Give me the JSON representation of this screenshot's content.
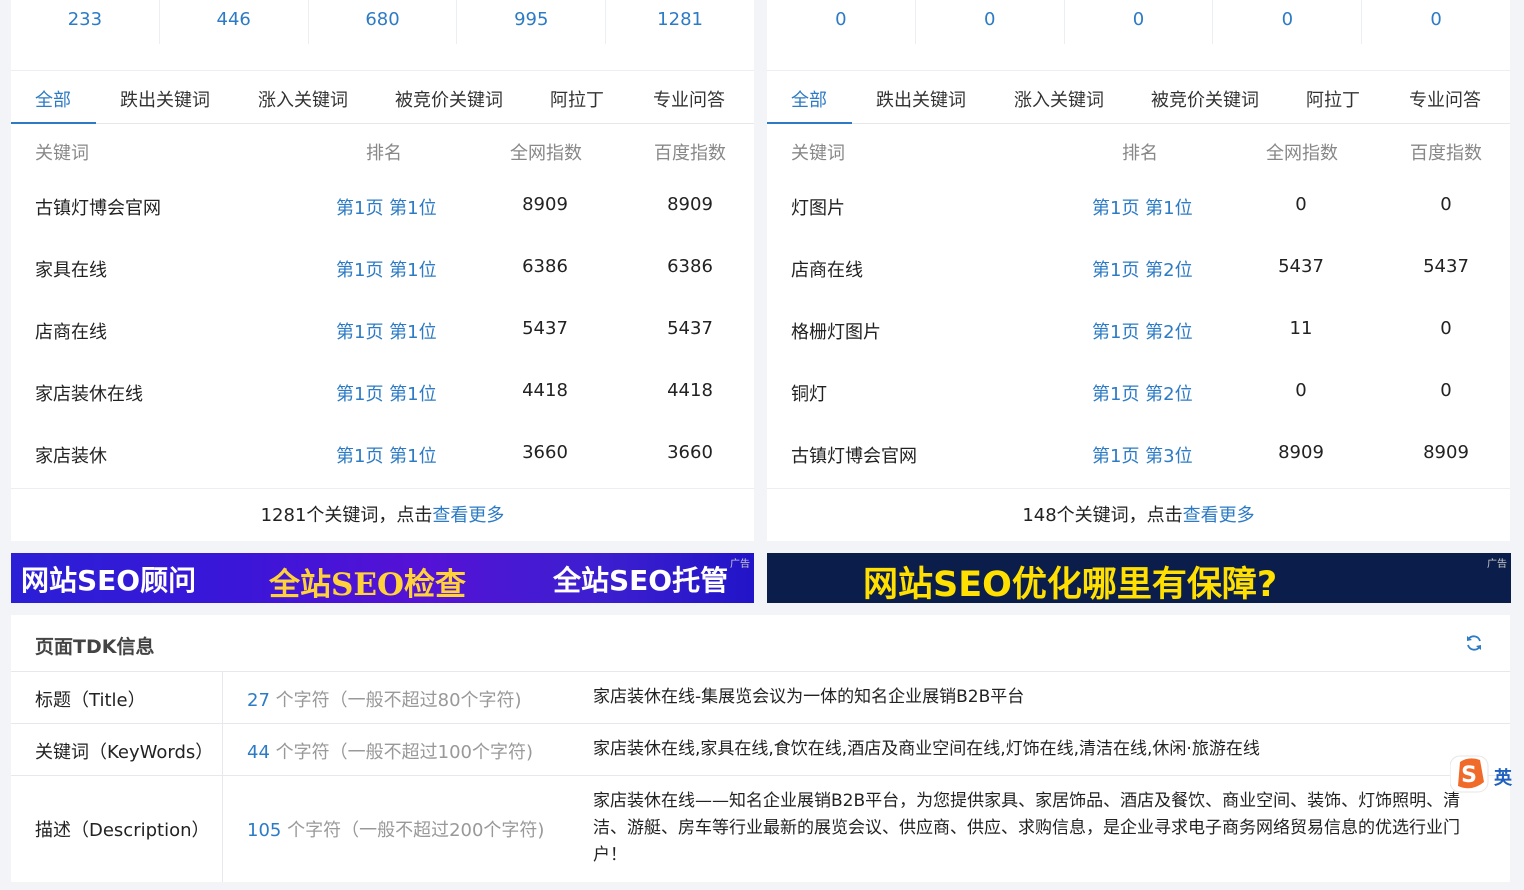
{
  "left": {
    "stats": [
      "233",
      "446",
      "680",
      "995",
      "1281"
    ],
    "tabs": [
      "全部",
      "跌出关键词",
      "涨入关键词",
      "被竞价关键词",
      "阿拉丁",
      "专业问答"
    ],
    "headers": {
      "keyword": "关键词",
      "rank": "排名",
      "all_index": "全网指数",
      "baidu_index": "百度指数"
    },
    "rows": [
      {
        "keyword": "古镇灯博会官网",
        "rank": "第1页 第1位",
        "all_index": "8909",
        "baidu_index": "8909"
      },
      {
        "keyword": "家具在线",
        "rank": "第1页 第1位",
        "all_index": "6386",
        "baidu_index": "6386"
      },
      {
        "keyword": "店商在线",
        "rank": "第1页 第1位",
        "all_index": "5437",
        "baidu_index": "5437"
      },
      {
        "keyword": "家店装休在线",
        "rank": "第1页 第1位",
        "all_index": "4418",
        "baidu_index": "4418"
      },
      {
        "keyword": "家店装休",
        "rank": "第1页 第1位",
        "all_index": "3660",
        "baidu_index": "3660"
      }
    ],
    "footer_text": "1281个关键词，点击",
    "footer_link": "查看更多"
  },
  "right": {
    "stats": [
      "0",
      "0",
      "0",
      "0",
      "0"
    ],
    "tabs": [
      "全部",
      "跌出关键词",
      "涨入关键词",
      "被竞价关键词",
      "阿拉丁",
      "专业问答"
    ],
    "headers": {
      "keyword": "关键词",
      "rank": "排名",
      "all_index": "全网指数",
      "baidu_index": "百度指数"
    },
    "rows": [
      {
        "keyword": "灯图片",
        "rank": "第1页 第1位",
        "all_index": "0",
        "baidu_index": "0"
      },
      {
        "keyword": "店商在线",
        "rank": "第1页 第2位",
        "all_index": "5437",
        "baidu_index": "5437"
      },
      {
        "keyword": "格栅灯图片",
        "rank": "第1页 第2位",
        "all_index": "11",
        "baidu_index": "0"
      },
      {
        "keyword": "铜灯",
        "rank": "第1页 第2位",
        "all_index": "0",
        "baidu_index": "0"
      },
      {
        "keyword": "古镇灯博会官网",
        "rank": "第1页 第3位",
        "all_index": "8909",
        "baidu_index": "8909"
      }
    ],
    "footer_text": "148个关键词，点击",
    "footer_link": "查看更多"
  },
  "banners": {
    "left": {
      "texts": [
        "网站SEO顾问",
        "全站SEO检查",
        "全站SEO托管"
      ],
      "tag": "广告"
    },
    "right": {
      "text": "网站SEO优化哪里有保障?",
      "tag": "广告"
    }
  },
  "tdk": {
    "title": "页面TDK信息",
    "rows": [
      {
        "label": "标题（Title）",
        "count": "27",
        "count_suffix": " 个字符（一般不超过80个字符)",
        "value": "家店装休在线-集展览会议为一体的知名企业展销B2B平台"
      },
      {
        "label": "关键词（KeyWords）",
        "count": "44",
        "count_suffix": " 个字符（一般不超过100个字符)",
        "value": "家店装休在线,家具在线,食饮在线,酒店及商业空间在线,灯饰在线,清洁在线,休闲·旅游在线"
      },
      {
        "label": "描述（Description）",
        "count": "105",
        "count_suffix": " 个字符（一般不超过200个字符)",
        "value": "家店装休在线——知名企业展销B2B平台，为您提供家具、家居饰品、酒店及餐饮、商业空间、装饰、灯饰照明、清洁、游艇、房车等行业最新的展览会议、供应商、供应、求购信息，是企业寻求电子商务网络贸易信息的优选行业门户！"
      }
    ]
  },
  "ime": {
    "label": "英"
  },
  "colors": {
    "accent": "#2d7bc5",
    "banner_left_text": "#ffd23a",
    "banner_right_text": "#ffe000"
  }
}
